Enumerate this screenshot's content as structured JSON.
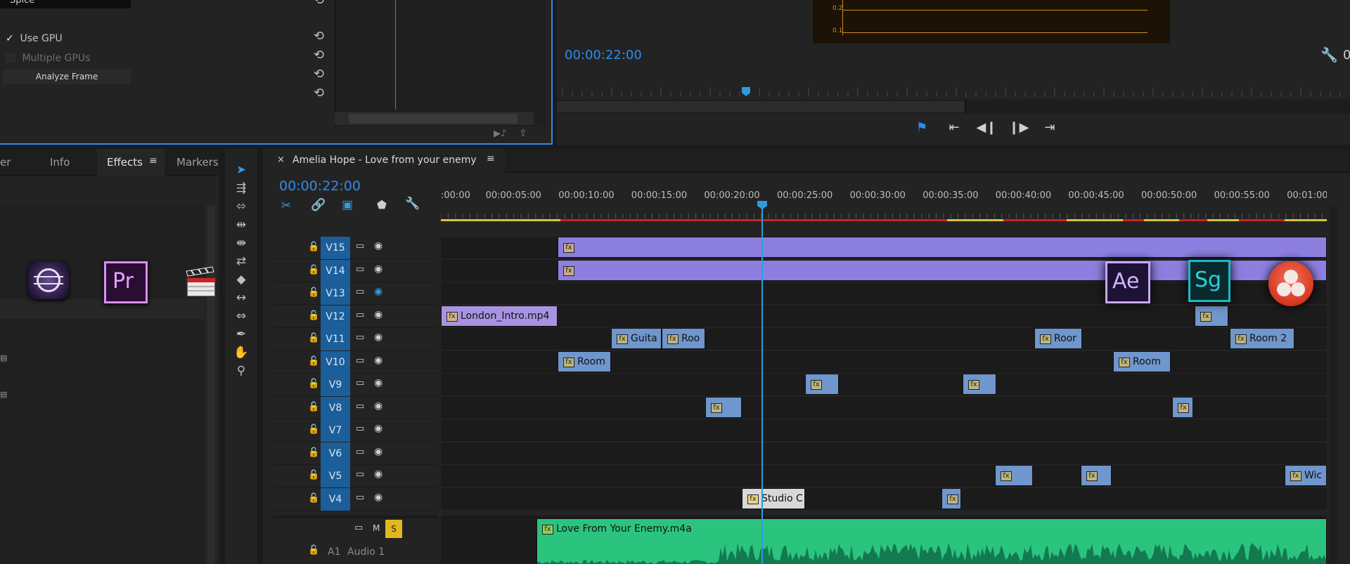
{
  "effect_controls": {
    "dropdown_value": "Spice",
    "use_gpu_label": "Use GPU",
    "multiple_gpus_label": "Multiple GPUs",
    "analyze_frame_label": "Analyze Frame"
  },
  "program_monitor": {
    "timecode": "00:00:22:00",
    "scope_labels": [
      "0.2",
      "0.1"
    ],
    "right_edge_text": "0"
  },
  "left_panel": {
    "tabs": [
      "er",
      "Info",
      "Effects",
      "Markers"
    ],
    "active_tab": "Effects"
  },
  "timeline": {
    "sequence_name": "Amelia Hope - Love from your enemy",
    "timecode": "00:00:22:00",
    "ruler_labels": [
      ":00:00",
      "00:00:05:00",
      "00:00:10:00",
      "00:00:15:00",
      "00:00:20:00",
      "00:00:25:00",
      "00:00:30:00",
      "00:00:35:00",
      "00:00:40:00",
      "00:00:45:00",
      "00:00:50:00",
      "00:00:55:00",
      "00:01:00"
    ],
    "video_tracks": [
      "V15",
      "V14",
      "V13",
      "V12",
      "V11",
      "V10",
      "V9",
      "V8",
      "V7",
      "V6",
      "V5",
      "V4"
    ],
    "clips": {
      "london_intro": "London_Intro.mp4",
      "guitar": "Guita",
      "room_v11a": "Roo",
      "room_v11b": "Roor",
      "room2": "Room 2",
      "room_v10a": "Room",
      "room_v10b": "Room",
      "studio": "Studio C",
      "wide": "Wic",
      "audio": "Love From Your Enemy.m4a"
    },
    "audio_track": {
      "id": "A1",
      "name": "Audio 1",
      "m_label": "M",
      "s_label": "S"
    }
  },
  "app_logos": {
    "premiere": "Pr",
    "after_effects": "Ae",
    "speedgrade": "Sg"
  },
  "colors": {
    "accent_blue": "#2d8ceb",
    "track_label_blue": "#1c5e99",
    "clip_purple": "#8d7fe0",
    "clip_blue": "#6f96cd",
    "clip_green": "#2bc47f"
  }
}
